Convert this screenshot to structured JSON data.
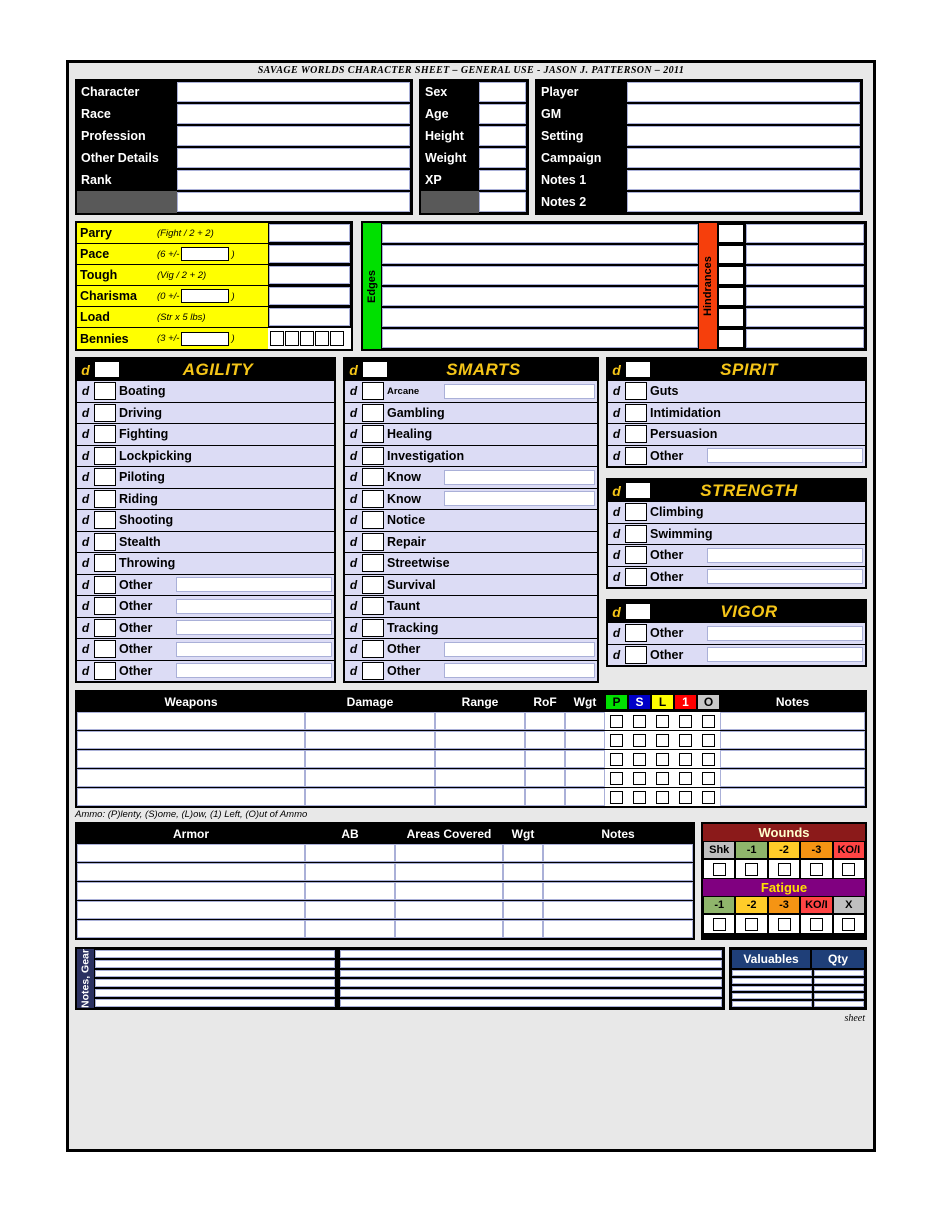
{
  "title": "SAVAGE WORLDS CHARACTER SHEET – GENERAL USE - JASON J. PATTERSON – 2011",
  "footer": "sheet",
  "identity": {
    "col_a": [
      "Character",
      "Race",
      "Profession",
      "Other Details",
      "Rank",
      ""
    ],
    "col_b": [
      "Sex",
      "Age",
      "Height",
      "Weight",
      "XP",
      ""
    ],
    "col_c": [
      "Player",
      "GM",
      "Setting",
      "Campaign",
      "Notes 1",
      "Notes 2"
    ]
  },
  "derived": {
    "rows": [
      {
        "name": "Parry",
        "formula": "(Fight / 2 + 2)",
        "has_input": false,
        "close": ""
      },
      {
        "name": "Pace",
        "formula": "(6 +/-",
        "has_input": true,
        "close": ")"
      },
      {
        "name": "Tough",
        "formula": "(Vig / 2 + 2)",
        "has_input": false,
        "close": ""
      },
      {
        "name": "Charisma",
        "formula": "(0 +/-",
        "has_input": true,
        "close": ")"
      },
      {
        "name": "Load",
        "formula": "(Str x 5 lbs)",
        "has_input": false,
        "close": ""
      },
      {
        "name": "Bennies",
        "formula": "(3 +/-",
        "has_input": true,
        "close": ")"
      }
    ],
    "benny_boxes": 5,
    "color_bg": "#ffff00"
  },
  "edges": {
    "label": "Edges",
    "color": "#00e000",
    "lines": 6
  },
  "hindrances": {
    "label": "Hindrances",
    "color": "#f63f0c",
    "lines": 6
  },
  "attributes": [
    {
      "name": "AGILITY",
      "die_prefix": "d",
      "skills": [
        {
          "label": "Boating",
          "blank": false
        },
        {
          "label": "Driving",
          "blank": false
        },
        {
          "label": "Fighting",
          "blank": false
        },
        {
          "label": "Lockpicking",
          "blank": false
        },
        {
          "label": "Piloting",
          "blank": false
        },
        {
          "label": "Riding",
          "blank": false
        },
        {
          "label": "Shooting",
          "blank": false
        },
        {
          "label": "Stealth",
          "blank": false
        },
        {
          "label": "Throwing",
          "blank": false
        },
        {
          "label": "Other",
          "blank": true
        },
        {
          "label": "Other",
          "blank": true
        },
        {
          "label": "Other",
          "blank": true
        },
        {
          "label": "Other",
          "blank": true
        },
        {
          "label": "Other",
          "blank": true
        }
      ]
    },
    {
      "name": "SMARTS",
      "die_prefix": "d",
      "skills": [
        {
          "label": "Arcane",
          "blank": true,
          "small": true
        },
        {
          "label": "Gambling",
          "blank": false
        },
        {
          "label": "Healing",
          "blank": false
        },
        {
          "label": "Investigation",
          "blank": false
        },
        {
          "label": "Know",
          "blank": true
        },
        {
          "label": "Know",
          "blank": true
        },
        {
          "label": "Notice",
          "blank": false
        },
        {
          "label": "Repair",
          "blank": false
        },
        {
          "label": "Streetwise",
          "blank": false
        },
        {
          "label": "Survival",
          "blank": false
        },
        {
          "label": "Taunt",
          "blank": false
        },
        {
          "label": "Tracking",
          "blank": false
        },
        {
          "label": "Other",
          "blank": true
        },
        {
          "label": "Other",
          "blank": true
        }
      ]
    },
    {
      "name": "SPIRIT",
      "die_prefix": "d",
      "skills": [
        {
          "label": "Guts",
          "blank": false
        },
        {
          "label": "Intimidation",
          "blank": false
        },
        {
          "label": "Persuasion",
          "blank": false
        },
        {
          "label": "Other",
          "blank": true
        }
      ]
    },
    {
      "name": "STRENGTH",
      "die_prefix": "d",
      "skills": [
        {
          "label": "Climbing",
          "blank": false
        },
        {
          "label": "Swimming",
          "blank": false
        },
        {
          "label": "Other",
          "blank": true
        },
        {
          "label": "Other",
          "blank": true
        }
      ]
    },
    {
      "name": "VIGOR",
      "die_prefix": "d",
      "skills": [
        {
          "label": "Other",
          "blank": true
        },
        {
          "label": "Other",
          "blank": true
        }
      ]
    }
  ],
  "weapons": {
    "headers": [
      "Weapons",
      "Damage",
      "Range",
      "RoF",
      "Wgt",
      "Notes"
    ],
    "ammo_headers": [
      "P",
      "S",
      "L",
      "1",
      "O"
    ],
    "rows": 5,
    "legend": "Ammo: (P)lenty, (S)ome, (L)ow, (1) Left, (O)ut of Ammo"
  },
  "armor": {
    "headers": [
      "Armor",
      "AB",
      "Areas Covered",
      "Wgt",
      "Notes"
    ],
    "rows": 5
  },
  "wounds": {
    "title": "Wounds",
    "labels": [
      "Shk",
      "-1",
      "-2",
      "-3",
      "KO/I"
    ],
    "title_bg": "#8b1a1a"
  },
  "fatigue": {
    "title": "Fatigue",
    "labels": [
      "-1",
      "-2",
      "-3",
      "KO/I",
      "X"
    ],
    "title_bg": "#800080"
  },
  "gear": {
    "tab_label": "Notes, Gear",
    "rows": 6
  },
  "valuables": {
    "headers": [
      "Valuables",
      "Qty"
    ],
    "rows": 5,
    "header_bg": "#1f3f78"
  }
}
